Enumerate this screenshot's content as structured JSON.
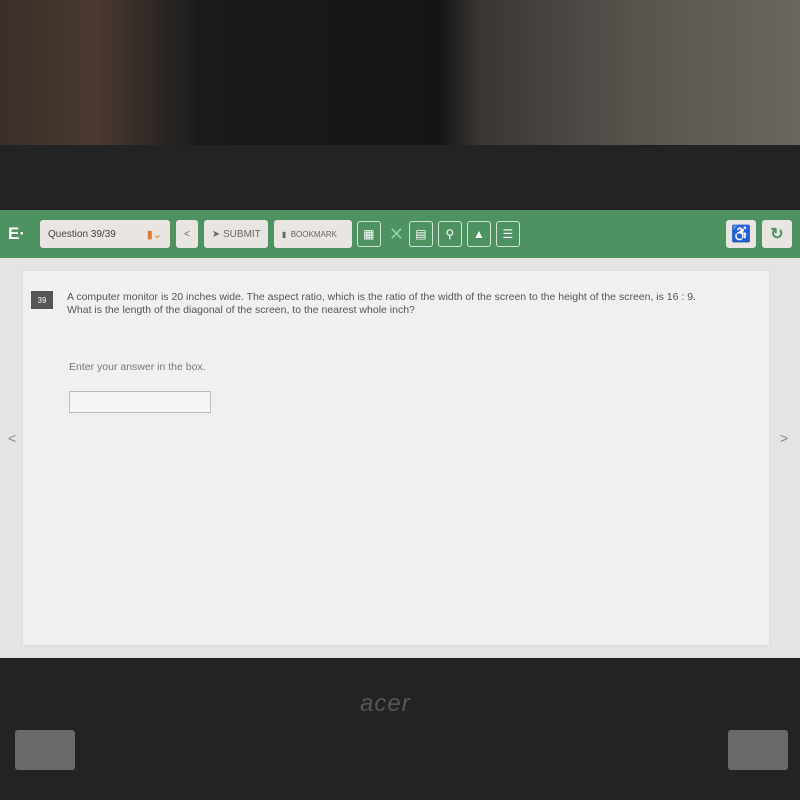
{
  "toolbar": {
    "logo": "E·",
    "question_selector": "Question 39/39",
    "back_label": "<",
    "submit_label": "SUBMIT",
    "bookmark_label": "BOOKMARK"
  },
  "question": {
    "number": "39",
    "text_line1": "A computer monitor is 20 inches wide. The aspect ratio, which is the ratio of the width of the screen to the height of the screen, is 16 : 9.",
    "text_line2": "What is the length of the diagonal of the screen, to the nearest whole inch?",
    "instruction": "Enter your answer in the box.",
    "answer_value": ""
  },
  "nav": {
    "prev": "<",
    "next": ">"
  },
  "laptop": {
    "brand": "acer"
  },
  "colors": {
    "toolbar": "#4e9262",
    "accent": "#e07a30"
  }
}
